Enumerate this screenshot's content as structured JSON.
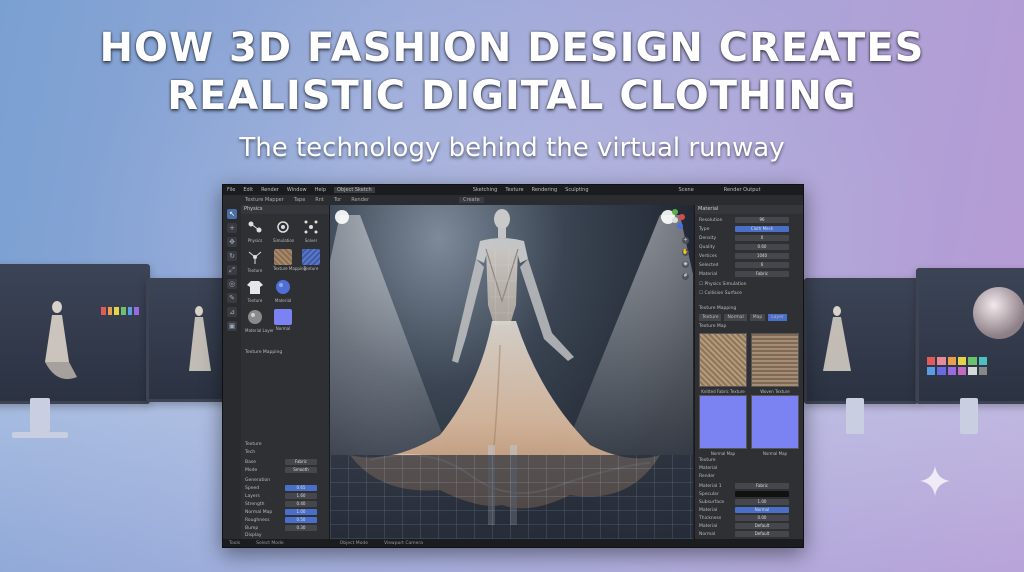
{
  "headline": {
    "line1": "HOW 3D FASHION DESIGN CREATES",
    "line2": "REALISTIC DIGITAL CLOTHING",
    "subtitle": "The technology behind the virtual runway"
  },
  "colors": {
    "background_left": "#7aa0d2",
    "background_right": "#b79ad4",
    "app_bg": "#232428",
    "accent_blue": "#4a6fc9",
    "normal_map": "#7b83f3"
  },
  "app": {
    "menu": [
      "File",
      "Edit",
      "Render",
      "Window",
      "Help",
      "Object Sketch"
    ],
    "toolbar": [
      "Texture Mapper",
      "Tape",
      "Rnt",
      "Tor",
      "Render"
    ],
    "viewport_tabs": [
      "Sketching",
      "Texture",
      "Rendering",
      "Sculpting"
    ],
    "viewport_mode": "Create",
    "scene_label": "Scene",
    "render_label": "Render Output",
    "left_panel": {
      "header": "Physics",
      "tools": [
        {
          "label": "Physics",
          "icon": "physics-icon"
        },
        {
          "label": "Simulation",
          "icon": "simulation-icon"
        },
        {
          "label": "Solver",
          "icon": "solver-icon"
        },
        {
          "label": "Texture",
          "icon": "node-icon"
        },
        {
          "label": "Texture Mapping",
          "icon": "texture-icon"
        },
        {
          "label": "Texture",
          "icon": "fabric-icon"
        },
        {
          "label": "Texture",
          "icon": "shirt-icon"
        },
        {
          "label": "Material",
          "icon": "sphere-icon"
        },
        {
          "label": "Material Layer",
          "icon": "sphere-gray-icon"
        },
        {
          "label": "Normal",
          "icon": "normal-icon"
        }
      ],
      "section_texture_mapping": "Texture Mapping",
      "section_texture": "Texture",
      "section_tech": "Tech",
      "rows": [
        {
          "label": "Base",
          "value": "Fabric"
        },
        {
          "label": "Mode",
          "value": "Smooth"
        },
        {
          "label": "Generation",
          "value": ""
        },
        {
          "label": "Speed",
          "value": "0.65"
        },
        {
          "label": "Layers",
          "value": "1.60"
        },
        {
          "label": "Strength",
          "value": "0.40"
        },
        {
          "label": "Normal Map",
          "value": "1.00"
        },
        {
          "label": "Roughness",
          "value": "0.50"
        },
        {
          "label": "Bump",
          "value": "0.30"
        },
        {
          "label": "Detail",
          "value": "1.00"
        }
      ],
      "footer": "Display"
    },
    "right_panel": {
      "header": "Material",
      "rows": [
        {
          "label": "Resolution",
          "value": "96"
        },
        {
          "label": "Type",
          "value": "Cloth Mesh",
          "blue": true
        },
        {
          "label": "Density",
          "value": "0"
        },
        {
          "label": "Quality",
          "value": "0.60"
        },
        {
          "label": "Vertices",
          "value": "1040"
        },
        {
          "label": "Selected",
          "value": "6"
        },
        {
          "label": "Material",
          "value": "Fabric"
        }
      ],
      "checks": [
        "Physics Simulation",
        "Collision Surface"
      ],
      "texture_mapping_header": "Texture Mapping",
      "texture_tabs": [
        "Texture",
        "Normal",
        "Map",
        "Layer"
      ],
      "texture_header": "Texture Map",
      "textures": [
        {
          "label": "Knitted Fabric Texture"
        },
        {
          "label": "Woven Texture"
        },
        {
          "label": "Normal Map"
        },
        {
          "label": "Normal Map"
        }
      ],
      "sections": [
        "Texture",
        "Material",
        "Render"
      ],
      "bottom_rows": [
        {
          "label": "Material 1",
          "value": "Fabric"
        },
        {
          "label": "Specular",
          "value": ""
        },
        {
          "label": "Subsurface",
          "value": "1.00"
        },
        {
          "label": "Material",
          "value": "Normal"
        },
        {
          "label": "Thickness",
          "value": "0.00"
        },
        {
          "label": "Material",
          "value": "Default"
        },
        {
          "label": "Normal",
          "value": "Default"
        }
      ]
    },
    "status": [
      "Tools",
      "Select Mode",
      "Object Mode",
      "Viewport Camera"
    ]
  }
}
